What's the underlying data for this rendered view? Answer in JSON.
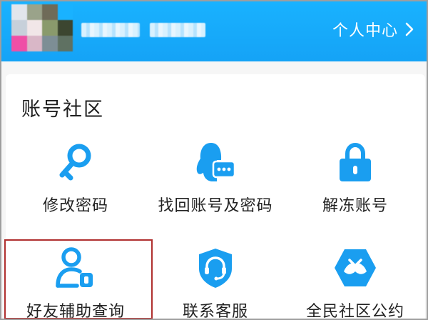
{
  "header": {
    "personal_center_label": "个人中心",
    "accent_color": "#15a3f6"
  },
  "section": {
    "title": "账号社区"
  },
  "tiles": [
    {
      "label": "修改密码",
      "icon": "key-icon"
    },
    {
      "label": "找回账号及密码",
      "icon": "penguin-chat-icon"
    },
    {
      "label": "解冻账号",
      "icon": "unlock-icon"
    },
    {
      "label": "好友辅助查询",
      "icon": "friend-assist-icon"
    },
    {
      "label": "联系客服",
      "icon": "customer-service-icon"
    },
    {
      "label": "全民社区公约",
      "icon": "community-handshake-icon"
    }
  ],
  "highlight_color": "#b0302f"
}
